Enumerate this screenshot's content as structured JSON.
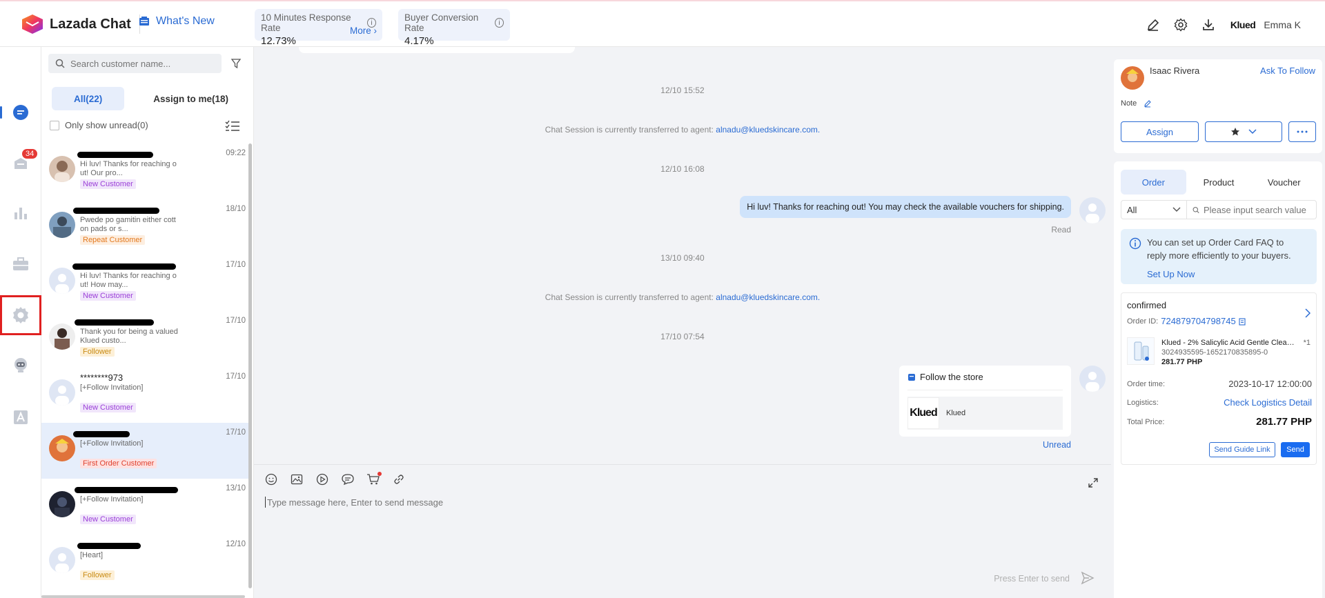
{
  "header": {
    "app_name": "Lazada Chat",
    "whats_new": "What's New",
    "metrics": [
      {
        "label": "10 Minutes Response Rate",
        "value": "12.73%",
        "more": "More ›"
      },
      {
        "label": "Buyer Conversion Rate",
        "value": "4.17%"
      }
    ],
    "brand": "Klued",
    "user": "Emma K"
  },
  "rail": {
    "badge": "34",
    "items": [
      "chat-icon",
      "orders-icon",
      "analytics-icon",
      "briefcase-icon",
      "settings-icon",
      "bot-icon",
      "text-icon"
    ]
  },
  "list": {
    "search_placeholder": "Search customer name...",
    "tabs": [
      {
        "label": "All(22)"
      },
      {
        "label": "Assign to me(18)"
      }
    ],
    "unread_label": "Only show unread(0)",
    "conversations": [
      {
        "name": "",
        "time": "09:22",
        "msg": "Hi luv! Thanks for reaching o ut! Our pro...",
        "tag": "New Customer"
      },
      {
        "name": "",
        "time": "18/10",
        "msg": "Pwede po gamitin either cott on pads or s...",
        "tag": "Repeat Customer"
      },
      {
        "name": "",
        "time": "17/10",
        "msg": "Hi luv! Thanks for reaching o ut! How may...",
        "tag": "New Customer"
      },
      {
        "name": "",
        "time": "17/10",
        "msg": "Thank you for being a valued Klued custo...",
        "tag": "Follower"
      },
      {
        "name": "********973",
        "time": "17/10",
        "msg": "[+Follow Invitation]",
        "tag": "New Customer"
      },
      {
        "name": "",
        "time": "17/10",
        "msg": "[+Follow Invitation]",
        "tag": "First Order Customer"
      },
      {
        "name": "",
        "time": "13/10",
        "msg": "[+Follow Invitation]",
        "tag": "New Customer"
      },
      {
        "name": "",
        "time": "12/10",
        "msg": "[Heart]",
        "tag": "Follower"
      }
    ]
  },
  "chat": {
    "stamps": [
      "12/10 15:52",
      "12/10 16:08",
      "13/10 09:40",
      "17/10 07:54"
    ],
    "system_prefix": "Chat Session is currently transferred to agent:",
    "agent_email": "alnadu@kluedskincare.com.",
    "bubble": "Hi luv! Thanks for reaching out! You may check the available vouchers for shipping.",
    "read": "Read",
    "follow_title": "Follow the store",
    "store_logo": "Klued",
    "store_name": "Klued",
    "unread": "Unread",
    "input_placeholder": "Type message here, Enter to send message",
    "send_hint": "Press Enter to send"
  },
  "customer": {
    "name": "Isaac Rivera",
    "ask_follow": "Ask To Follow",
    "note": "Note",
    "assign": "Assign"
  },
  "order_panel": {
    "tabs": [
      "Order",
      "Product",
      "Voucher"
    ],
    "filter": "All",
    "search_placeholder": "Please input search value",
    "faq_text": "You can set up Order Card FAQ to reply more efficiently to your buyers.",
    "setup": "Set Up Now",
    "order": {
      "status": "confirmed",
      "id_label": "Order ID:",
      "id": "724879704798745",
      "product": "Klued - 2% Salicylic Acid Gentle Cleans...",
      "qty": "*1",
      "sku": "3024935595-1652170835895-0",
      "price": "281.77 PHP",
      "time_label": "Order time:",
      "time": "2023-10-17 12:00:00",
      "logistics_label": "Logistics:",
      "logistics": "Check Logistics Detail",
      "total_label": "Total Price:",
      "total": "281.77 PHP",
      "guide_btn": "Send Guide Link",
      "send_btn": "Send"
    }
  },
  "colors": {
    "accent": "#2a6bd3",
    "highlight": "#e02020"
  }
}
